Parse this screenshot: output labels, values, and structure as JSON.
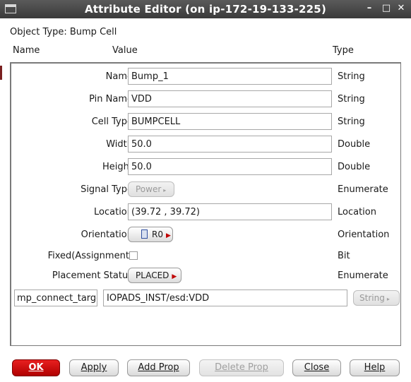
{
  "window": {
    "title": "Attribute Editor (on ip-172-19-133-225)",
    "minimize_glyph": "–",
    "maximize_glyph": "□",
    "close_glyph": "✕"
  },
  "object_type": {
    "label": "Object Type:",
    "value": "Bump Cell"
  },
  "headers": {
    "name": "Name",
    "value": "Value",
    "type": "Type"
  },
  "properties": [
    {
      "name": "Name",
      "value": "Bump_1",
      "type": "String"
    },
    {
      "name": "Pin Name",
      "value": "VDD",
      "type": "String"
    },
    {
      "name": "Cell Type",
      "value": "BUMPCELL",
      "type": "String"
    },
    {
      "name": "Width",
      "value": "50.0",
      "type": "Double"
    },
    {
      "name": "Height",
      "value": "50.0",
      "type": "Double"
    },
    {
      "name": "Signal Type",
      "value": "Power",
      "type": "Enumerate",
      "disabled": true
    },
    {
      "name": "Location",
      "value": "(39.72 , 39.72)",
      "type": "Location"
    },
    {
      "name": "Orientation",
      "value": "R0",
      "type": "Orientation",
      "icon": "orientation-icon"
    },
    {
      "name": "Fixed(Assignment)",
      "value": "",
      "type": "Bit",
      "checked": false
    },
    {
      "name": "Placement Status",
      "value": "PLACED",
      "type": "Enumerate"
    }
  ],
  "custom_prop": {
    "name": "mp_connect_target",
    "value": "IOPADS_INST/esd:VDD",
    "type_button": "String",
    "type_disabled": true
  },
  "buttons": {
    "ok": "OK",
    "apply": "Apply",
    "add_prop": "Add Prop",
    "delete_prop": "Delete Prop",
    "close": "Close",
    "help": "Help"
  },
  "colors": {
    "titlebar": "#3a3a3a",
    "ok_button": "#d01010",
    "accent_arrow": "#c00000"
  }
}
